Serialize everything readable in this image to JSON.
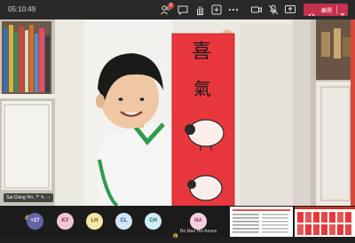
{
  "meeting": {
    "timer": "05:10:49"
  },
  "toolbar": {
    "participants_badge": "3",
    "leave_label": "離開",
    "icons": [
      "participants-icon",
      "chat-icon",
      "raise-hand-icon",
      "reactions-icon",
      "more-icon",
      "camera-icon",
      "mic-icon",
      "share-icon",
      "phone-icon",
      "chevron-down-icon"
    ]
  },
  "video": {
    "speaker_name": "Sai Ching Yin",
    "scroll_characters": [
      "喜",
      "氣"
    ]
  },
  "roster": {
    "overflow": "+27",
    "avatars": [
      "KY",
      "LH",
      "CL",
      "CH",
      "NA"
    ],
    "raised_hand_name": "Bo Man Hin Anson"
  },
  "colors": {
    "leave_button": "#c4314b",
    "scroll_red": "#e8383d",
    "accent": "#6264a7"
  }
}
